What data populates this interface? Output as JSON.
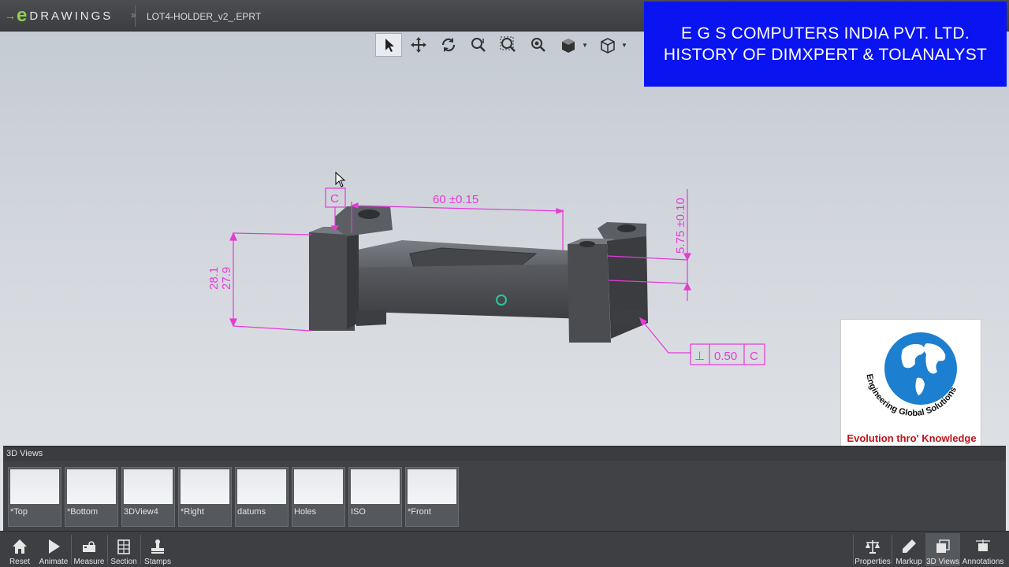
{
  "app": {
    "logo_text": "DRAWINGS",
    "logo_mark": "e",
    "file_name": "LOT4-HOLDER_v2_.EPRT"
  },
  "view_toolbar": {
    "tools": [
      {
        "name": "select",
        "icon": "arrow-pointer-icon",
        "active": true
      },
      {
        "name": "pan",
        "icon": "pan-arrows-icon"
      },
      {
        "name": "rotate",
        "icon": "rotate-icon"
      },
      {
        "name": "zoom",
        "icon": "zoom-icon"
      },
      {
        "name": "zoom-area",
        "icon": "zoom-area-icon"
      },
      {
        "name": "zoom-fit",
        "icon": "zoom-fit-icon"
      },
      {
        "name": "display-style",
        "icon": "display-style-icon",
        "has_dropdown": true
      },
      {
        "name": "standard-views",
        "icon": "cube-icon",
        "has_dropdown": true
      }
    ]
  },
  "banner": {
    "line1": "E G S COMPUTERS INDIA PVT. LTD.",
    "line2": "HISTORY OF DIMXPERT & TOLANALYST",
    "background": "#0a14f0"
  },
  "logo_card": {
    "arc_text": "Engineering Global Solutions",
    "tagline": "Evolution thro' Knowledge"
  },
  "annotations": {
    "datum_top": "C",
    "dim_horizontal": "60 ±0.15",
    "dim_vertical_right": "5.75 ±0.10",
    "dim_left_1": "28.1",
    "dim_left_2": "27.9",
    "gtol_symbol": "⊥",
    "gtol_value": "0.50",
    "gtol_datum": "C",
    "color": "#e63ad8"
  },
  "views_panel": {
    "header": "3D Views",
    "views": [
      {
        "label": "*Top"
      },
      {
        "label": "*Bottom"
      },
      {
        "label": "3DView4"
      },
      {
        "label": "*Right"
      },
      {
        "label": "datums"
      },
      {
        "label": "Holes"
      },
      {
        "label": "ISO"
      },
      {
        "label": "*Front"
      }
    ]
  },
  "bottom_bar": {
    "left": [
      {
        "label": "Reset",
        "icon": "home-icon"
      },
      {
        "label": "Animate",
        "icon": "play-icon"
      },
      {
        "label": "Measure",
        "icon": "measure-icon"
      },
      {
        "label": "Section",
        "icon": "section-icon"
      },
      {
        "label": "Stamps",
        "icon": "stamp-icon"
      }
    ],
    "right": [
      {
        "label": "Properties",
        "icon": "scale-icon"
      },
      {
        "label": "Markup",
        "icon": "pen-icon"
      },
      {
        "label": "3D Views",
        "icon": "views-icon",
        "active": true
      },
      {
        "label": "Annotations",
        "icon": "annotations-icon"
      }
    ]
  }
}
